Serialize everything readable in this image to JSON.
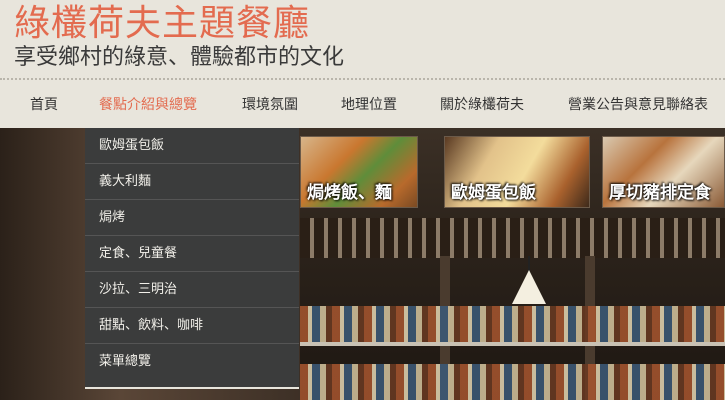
{
  "header": {
    "title": "綠欉荷夫主題餐廳",
    "subtitle": "享受鄉村的綠意、體驗都市的文化"
  },
  "nav": {
    "items": [
      {
        "label": "首頁"
      },
      {
        "label": "餐點介紹與總覽",
        "active": true
      },
      {
        "label": "環境氛圍"
      },
      {
        "label": "地理位置"
      },
      {
        "label": "關於綠欉荷夫"
      },
      {
        "label": "營業公告與意見聯絡表"
      }
    ]
  },
  "dropdown": {
    "items": [
      {
        "label": "歐姆蛋包飯"
      },
      {
        "label": "義大利麵"
      },
      {
        "label": "焗烤"
      },
      {
        "label": "定食、兒童餐"
      },
      {
        "label": "沙拉、三明治"
      },
      {
        "label": "甜點、飲料、咖啡"
      },
      {
        "label": "菜單總覽"
      }
    ]
  },
  "hero": {
    "banners": [
      {
        "label": "焗烤飯、麵"
      },
      {
        "label": "歐姆蛋包飯"
      },
      {
        "label": "厚切豬排定食"
      }
    ]
  },
  "colors": {
    "accent": "#e36b4f",
    "background": "#e8e5dc",
    "dropdown_bg": "#3b3c3c"
  }
}
